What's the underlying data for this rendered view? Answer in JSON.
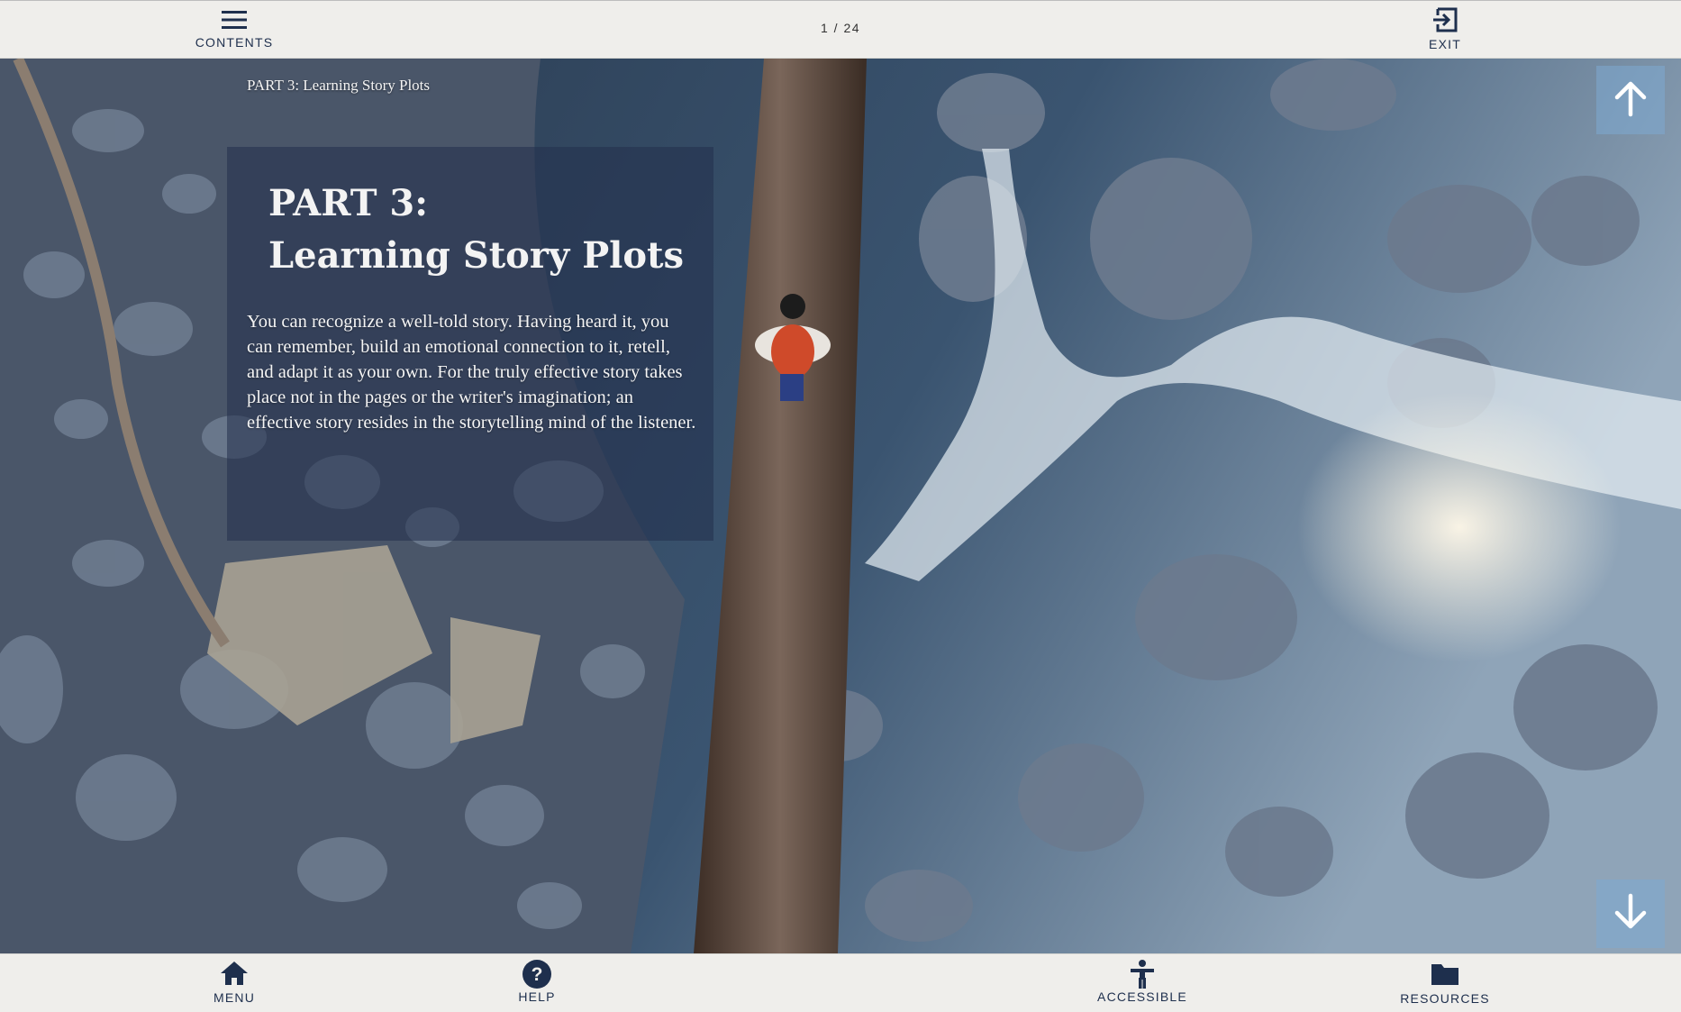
{
  "top_nav": {
    "contents_label": "CONTENTS",
    "page_counter": "1 / 24",
    "exit_label": "EXIT"
  },
  "slide": {
    "breadcrumb": "PART 3: Learning Story Plots",
    "title_line1": "PART 3:",
    "title_line2": "Learning Story Plots",
    "body": "You can recognize a well-told story. Having heard it, you can remember, build an emotional connection to it, retell, and adapt it as your own. For the truly effective story takes place not in the pages or the writer's imagination; an effective story resides in the storytelling mind of the listener."
  },
  "bottom_nav": {
    "menu_label": "MENU",
    "help_label": "HELP",
    "accessible_label": "ACCESSIBLE",
    "resources_label": "RESOURCES"
  },
  "icons": {
    "contents": "hamburger-icon",
    "exit": "exit-icon",
    "scroll_up": "arrow-up-icon",
    "scroll_down": "arrow-down-icon",
    "menu": "home-icon",
    "help": "help-circle-icon",
    "accessible": "accessibility-icon",
    "resources": "folder-icon"
  },
  "colors": {
    "nav_icon": "#1e2f4d",
    "bar_background": "#efeeeb",
    "text_panel": "#22304c",
    "arrow_button": "#7daad2"
  }
}
